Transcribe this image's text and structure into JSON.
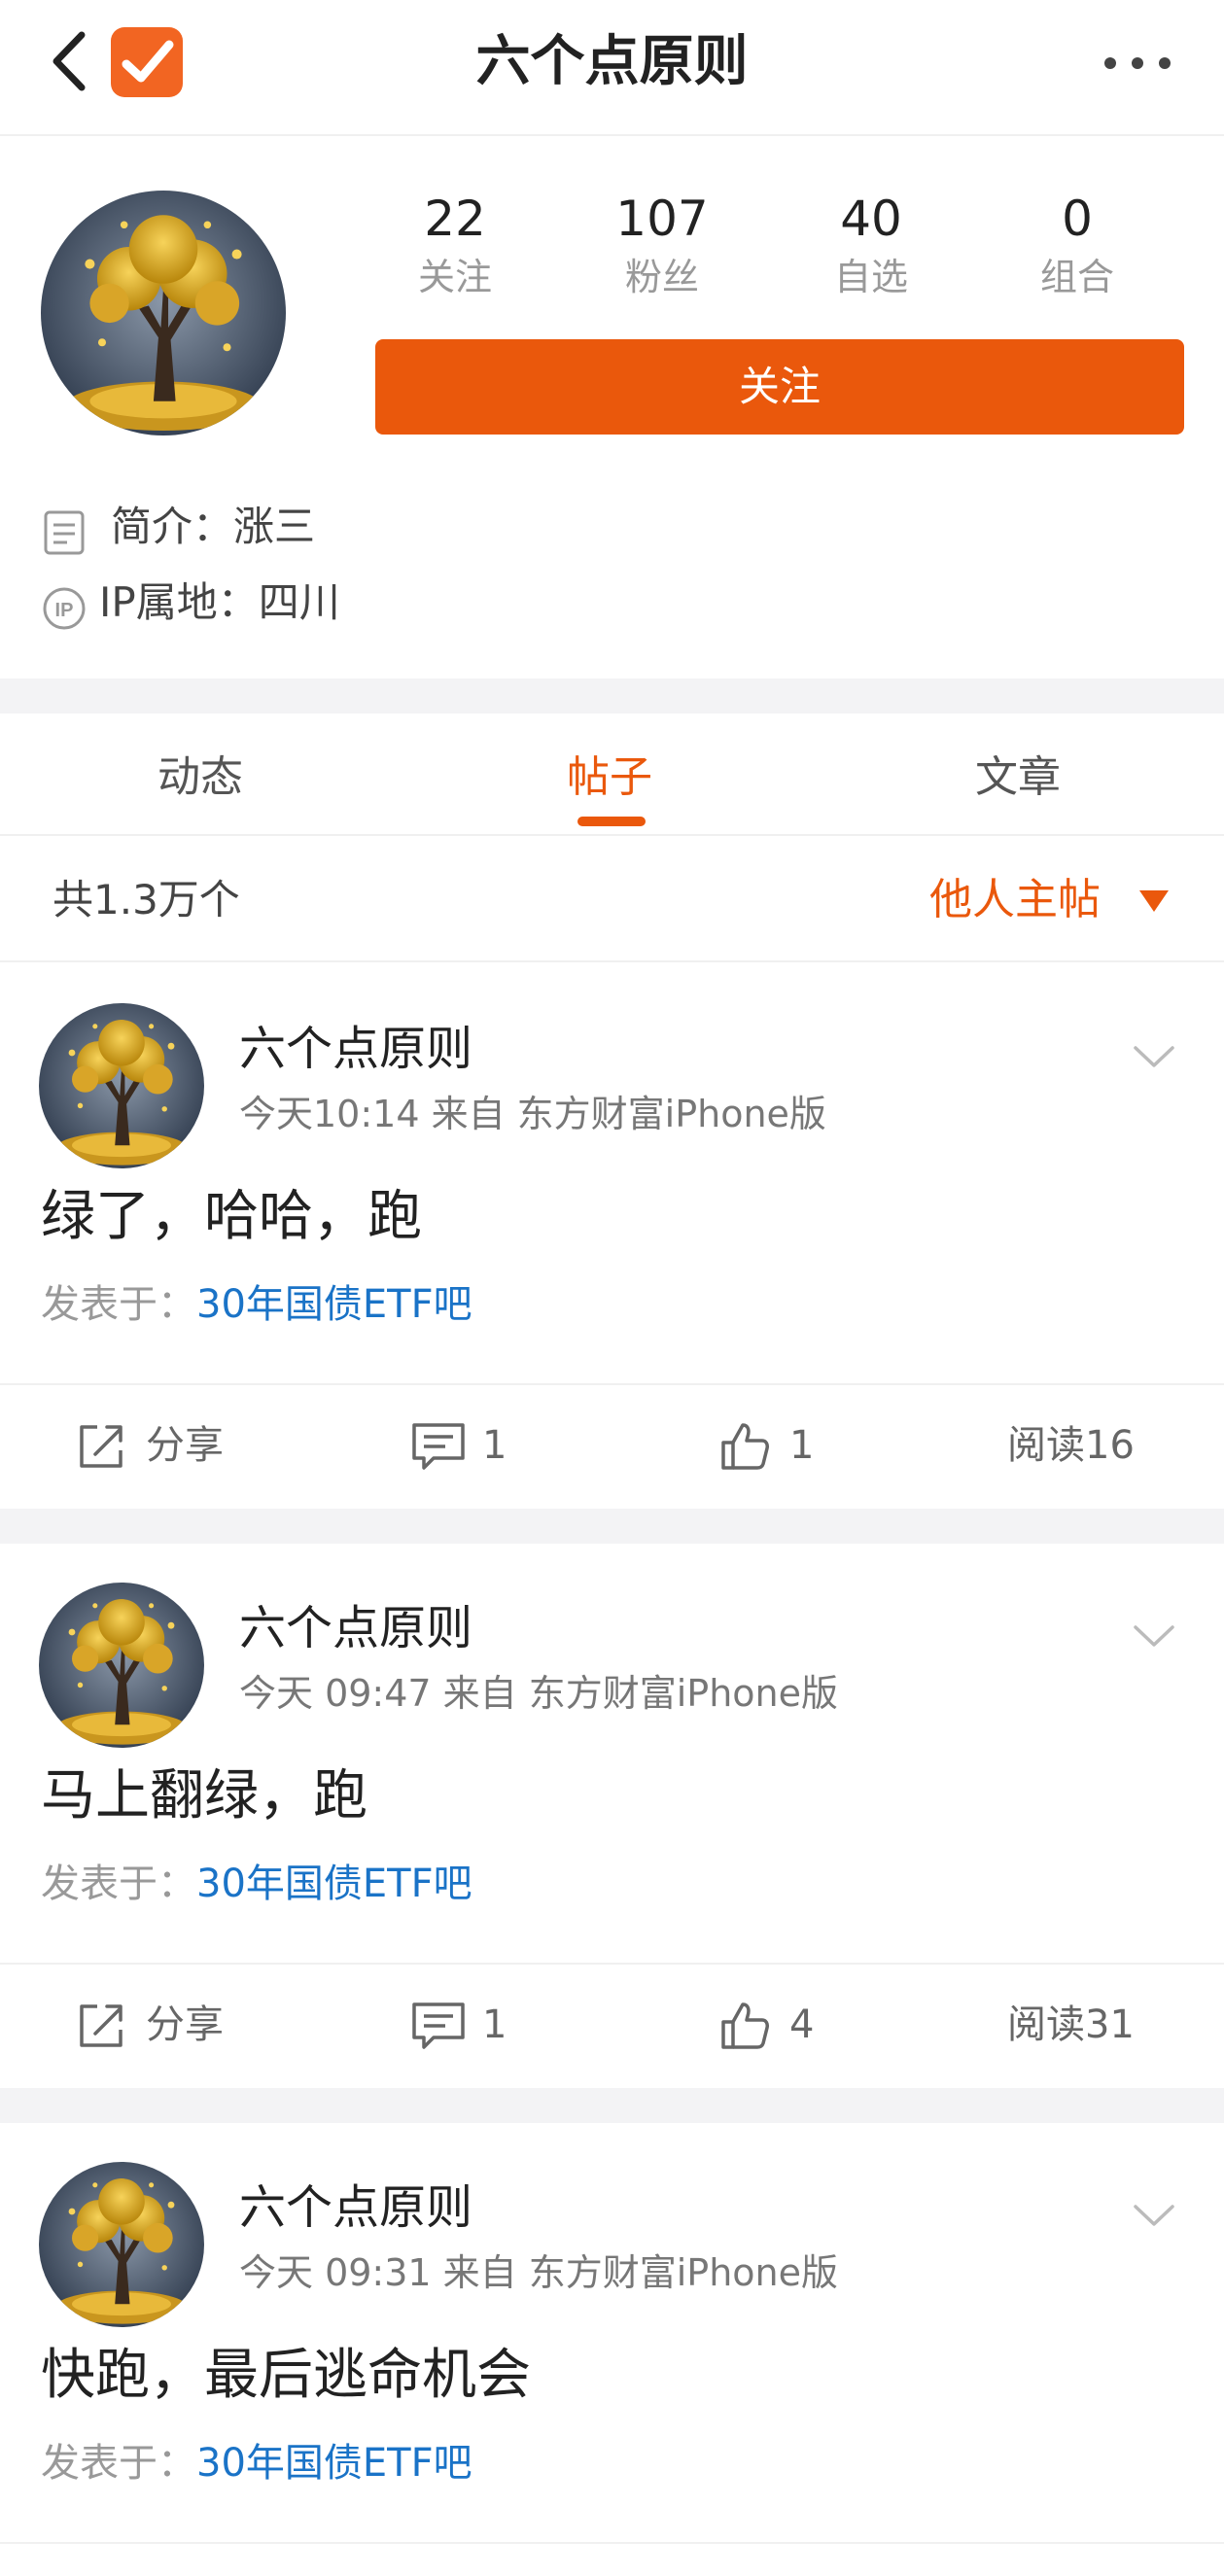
{
  "header": {
    "title": "六个点原则"
  },
  "profile": {
    "stats": [
      {
        "num": "22",
        "label": "关注"
      },
      {
        "num": "107",
        "label": "粉丝"
      },
      {
        "num": "40",
        "label": "自选"
      },
      {
        "num": "0",
        "label": "组合"
      }
    ],
    "follow_label": "关注",
    "bio": "简介：涨三",
    "ip": "IP属地：四川"
  },
  "tabs": [
    {
      "label": "动态",
      "active": false
    },
    {
      "label": "帖子",
      "active": true
    },
    {
      "label": "文章",
      "active": false
    }
  ],
  "list": {
    "count": "共1.3万个",
    "filter": "他人主帖"
  },
  "posts": [
    {
      "author": "六个点原则",
      "meta": "今天10:14   来自 东方财富iPhone版",
      "content": "绿了，哈哈，跑",
      "board_prefix": "发表于：",
      "board": "30年国债ETF吧",
      "share": "分享",
      "comments": "1",
      "likes": "1",
      "reads": "阅读16"
    },
    {
      "author": "六个点原则",
      "meta": "今天 09:47   来自 东方财富iPhone版",
      "content": "马上翻绿，跑",
      "board_prefix": "发表于：",
      "board": "30年国债ETF吧",
      "share": "分享",
      "comments": "1",
      "likes": "4",
      "reads": "阅读31"
    },
    {
      "author": "六个点原则",
      "meta": "今天 09:31   来自 东方财富iPhone版",
      "content": "快跑，最后逃命机会",
      "board_prefix": "发表于：",
      "board": "30年国债ETF吧"
    }
  ],
  "colors": {
    "accent": "#ea580c",
    "link": "#1a73c7",
    "band": "#f3f3f5"
  },
  "icons": [
    "back-icon",
    "app-logo-icon",
    "more-icon",
    "bio-icon",
    "ip-icon",
    "dropdown-triangle-icon",
    "chevron-down-icon",
    "share-icon",
    "comment-icon",
    "like-icon"
  ]
}
